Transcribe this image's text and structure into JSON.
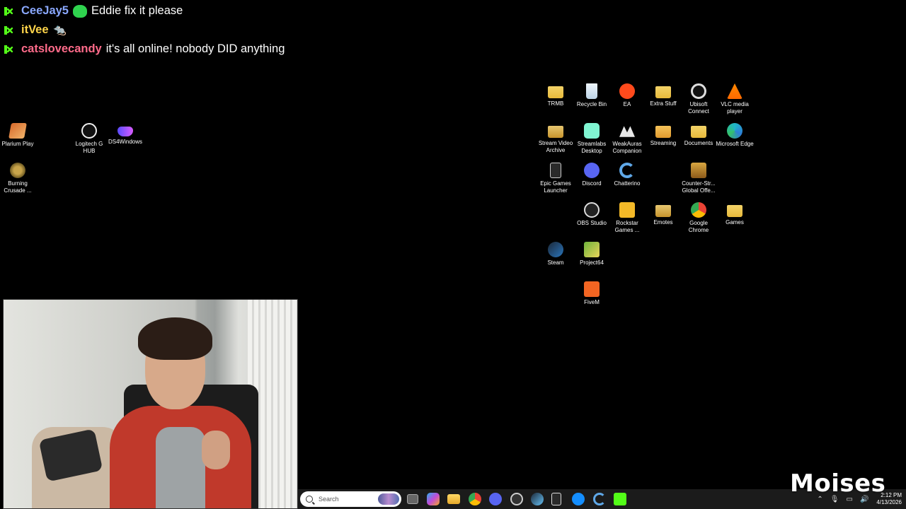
{
  "chat": {
    "messages": [
      {
        "user": "CeeJay5",
        "user_color": "#8aa8ff",
        "emote": "green-blob",
        "text": "Eddie fix it please"
      },
      {
        "user": "itVee",
        "user_color": "#ffd54a",
        "emote": "rat",
        "text": ""
      },
      {
        "user": "catslovecandy",
        "user_color": "#ff6b8a",
        "emote": "",
        "text": "it's all online! nobody DID anything"
      }
    ]
  },
  "desktop": {
    "left_icons": [
      {
        "label": "Plarium Play",
        "icon": "plarium-icon"
      },
      {
        "label": "Logitech G HUB",
        "icon": "logitech-icon"
      },
      {
        "label": "DS4Windows",
        "icon": "gamepad-icon"
      },
      {
        "label": "Burning Crusade ...",
        "icon": "wow-icon"
      }
    ],
    "right_icons": [
      {
        "label": "TRMB",
        "icon": "folder-icon"
      },
      {
        "label": "Recycle Bin",
        "icon": "recycle-bin-icon"
      },
      {
        "label": "EA",
        "icon": "ea-icon"
      },
      {
        "label": "Extra Stuff",
        "icon": "folder-icon"
      },
      {
        "label": "Ubisoft Connect",
        "icon": "ubisoft-icon"
      },
      {
        "label": "VLC media player",
        "icon": "vlc-icon"
      },
      {
        "label": "Stream Video Archive",
        "icon": "folder-icon"
      },
      {
        "label": "Streamlabs Desktop",
        "icon": "streamlabs-icon"
      },
      {
        "label": "WeakAuras Companion",
        "icon": "weakauras-icon"
      },
      {
        "label": "Streaming",
        "icon": "folder-icon"
      },
      {
        "label": "Documents",
        "icon": "folder-icon"
      },
      {
        "label": "Microsoft Edge",
        "icon": "edge-icon"
      },
      {
        "label": "Epic Games Launcher",
        "icon": "epic-icon"
      },
      {
        "label": "Discord",
        "icon": "discord-icon"
      },
      {
        "label": "Chatterino",
        "icon": "chatterino-icon"
      },
      {
        "label": "Counter-Str... Global Offe...",
        "icon": "csgo-icon"
      },
      {
        "label": "OBS Studio",
        "icon": "obs-icon"
      },
      {
        "label": "Rockstar Games ...",
        "icon": "rockstar-icon"
      },
      {
        "label": "Emotes",
        "icon": "folder-icon"
      },
      {
        "label": "Google Chrome",
        "icon": "chrome-icon"
      },
      {
        "label": "Games",
        "icon": "folder-icon"
      },
      {
        "label": "Steam",
        "icon": "steam-icon"
      },
      {
        "label": "Project64",
        "icon": "project64-icon"
      },
      {
        "label": "FiveM",
        "icon": "fivem-icon"
      }
    ]
  },
  "taskbar": {
    "search_placeholder": "Search",
    "time": "2:12 PM",
    "date": "4/13/2026",
    "apps": [
      "task-view-icon",
      "copilot-icon",
      "file-explorer-icon",
      "chrome-icon",
      "discord-icon",
      "obs-icon",
      "steam-icon",
      "epic-icon",
      "battlenet-icon",
      "chatterino-icon",
      "kick-icon"
    ]
  },
  "watermark": "Moises"
}
